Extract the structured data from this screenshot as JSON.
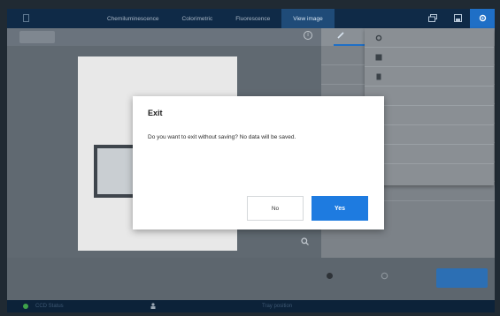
{
  "nav": {
    "tabs": [
      {
        "label": "Chemiluminescence"
      },
      {
        "label": "Colorimetric"
      },
      {
        "label": "Fluorescence"
      },
      {
        "label": "View image"
      }
    ]
  },
  "dialog": {
    "title": "Exit",
    "message": "Do you want to exit without saving? No data will be saved.",
    "no_label": "No",
    "yes_label": "Yes"
  },
  "status": {
    "ccd_label": "CCD Status",
    "tray_label": "Tray position"
  },
  "colors": {
    "primary": "#1e7be0",
    "nav_bg": "#0f2a47",
    "status_ok": "#3fa34a"
  }
}
